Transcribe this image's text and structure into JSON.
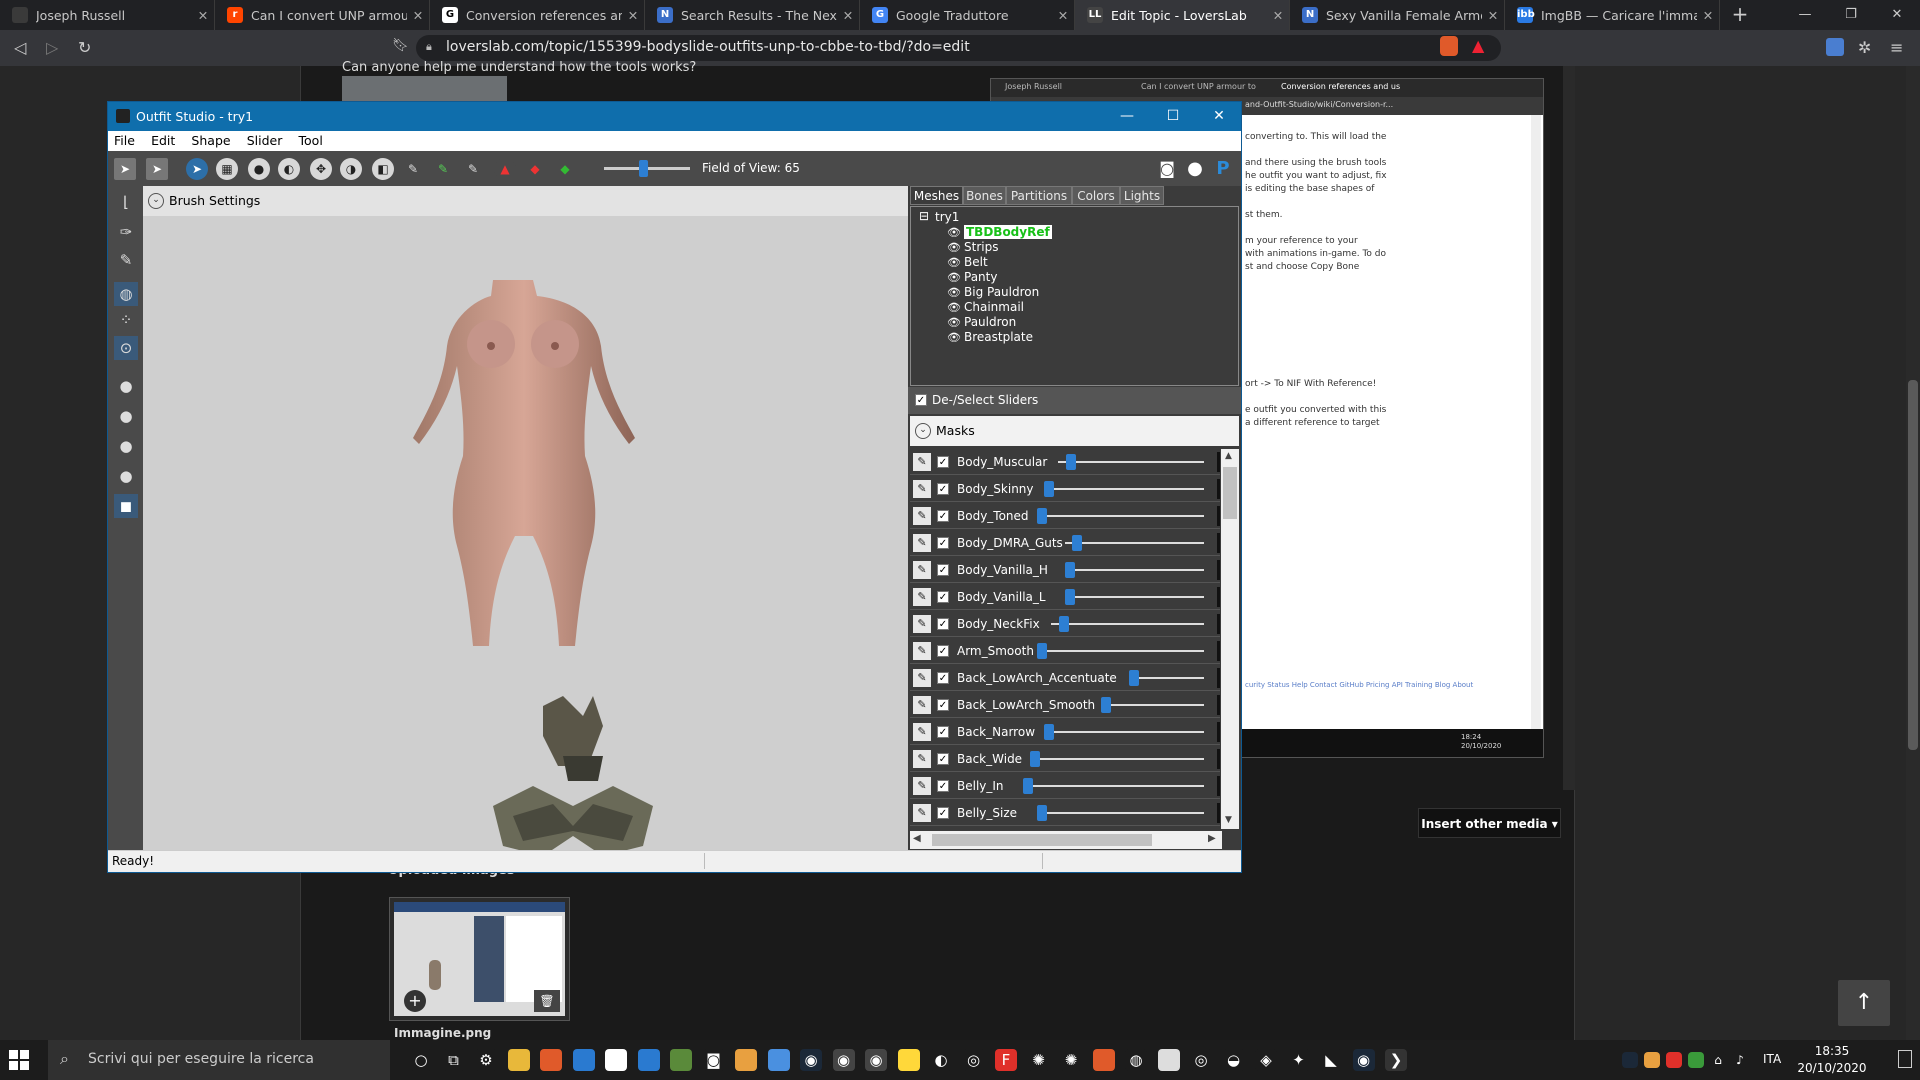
{
  "browser": {
    "tabs": [
      {
        "title": "Joseph Russell",
        "color": "#3a3a3a",
        "glyph": ""
      },
      {
        "title": "Can I convert UNP armour to",
        "color": "#ff4500",
        "glyph": "r"
      },
      {
        "title": "Conversion references and us",
        "color": "#ffffff",
        "glyph": "G"
      },
      {
        "title": "Search Results - The Nexus Fo",
        "color": "#3b6ec8",
        "glyph": "N"
      },
      {
        "title": "Google Traduttore",
        "color": "#4285f4",
        "glyph": "G"
      },
      {
        "title": "Edit Topic - LoversLab",
        "color": "#444444",
        "glyph": "LL"
      },
      {
        "title": "Sexy Vanilla Female Armor fo",
        "color": "#3b6ec8",
        "glyph": "N"
      },
      {
        "title": "ImgBB — Caricare l'immagin",
        "color": "#2a7ae4",
        "glyph": "ibb"
      }
    ],
    "url": "loverslab.com/topic/155399-bodyslide-outfits-unp-to-cbbe-to-tbd/?do=edit",
    "new_tab": "+",
    "win_controls": [
      "—",
      "❐",
      "✕"
    ]
  },
  "page": {
    "question": "Can anyone help me understand how the tools works?",
    "insert_other_media": "Insert other media ▾",
    "uploaded_images_label": "Uploaded images",
    "thumbnail_name": "Immagine.png"
  },
  "embedded_screenshot": {
    "tabs": [
      "Joseph Russell",
      "Can I convert UNP armour to",
      "Conversion references and us"
    ],
    "url": "and-Outfit-Studio/wiki/Conversion-r...",
    "lines": [
      "converting to. This will load the",
      "",
      "and there using the brush tools",
      "he outfit you want to adjust, fix",
      "is editing the base shapes of",
      "",
      "st them.",
      "",
      "m your reference to your",
      "with animations in-game. To do",
      "st and choose Copy Bone",
      "",
      "",
      "",
      "",
      "",
      "",
      "",
      "",
      "ort -> To NIF With Reference!",
      "",
      "e outfit you converted with this",
      "a different reference to target"
    ],
    "footer": "curity  Status  Help  Contact GitHub  Pricing  API  Training  Blog  About",
    "clock": "18:24\n20/10/2020"
  },
  "outfit_studio": {
    "title": "Outfit Studio - try1",
    "menu": [
      "File",
      "Edit",
      "Shape",
      "Slider",
      "Tool"
    ],
    "field_of_view_label": "Field of View: 65",
    "field_of_view_fraction": 0.45,
    "brush_settings_label": "Brush Settings",
    "panel_tabs": [
      "Meshes",
      "Bones",
      "Partitions",
      "Colors",
      "Lights"
    ],
    "active_tab": "Meshes",
    "project_root": "try1",
    "meshes": [
      "TBDBodyRef",
      "Strips",
      "Belt",
      "Panty",
      "Big Pauldron",
      "Chainmail",
      "Pauldron",
      "Breastplate"
    ],
    "selected_mesh": "TBDBodyRef",
    "deselect_sliders_label": "De-/Select Sliders",
    "masks_label": "Masks",
    "sliders": [
      {
        "name": "Body_Muscular",
        "value": 0.05
      },
      {
        "name": "Body_Skinny",
        "value": 0.0
      },
      {
        "name": "Body_Toned",
        "value": 0.0
      },
      {
        "name": "Body_DMRA_Guts",
        "value": 0.05
      },
      {
        "name": "Body_Vanilla_H",
        "value": 0.0
      },
      {
        "name": "Body_Vanilla_L",
        "value": 0.0
      },
      {
        "name": "Body_NeckFix",
        "value": 0.05
      },
      {
        "name": "Arm_Smooth",
        "value": 0.0
      },
      {
        "name": "Back_LowArch_Accentuate",
        "value": 0.0
      },
      {
        "name": "Back_LowArch_Smooth",
        "value": 0.0
      },
      {
        "name": "Back_Narrow",
        "value": 0.0
      },
      {
        "name": "Back_Wide",
        "value": 0.0
      },
      {
        "name": "Belly_In",
        "value": 0.0
      },
      {
        "name": "Belly_Size",
        "value": 0.0
      }
    ],
    "status": "Ready!"
  },
  "taskbar": {
    "search_placeholder": "Scrivi qui per eseguire la ricerca",
    "language": "ITA",
    "time": "18:35",
    "date": "20/10/2020"
  }
}
